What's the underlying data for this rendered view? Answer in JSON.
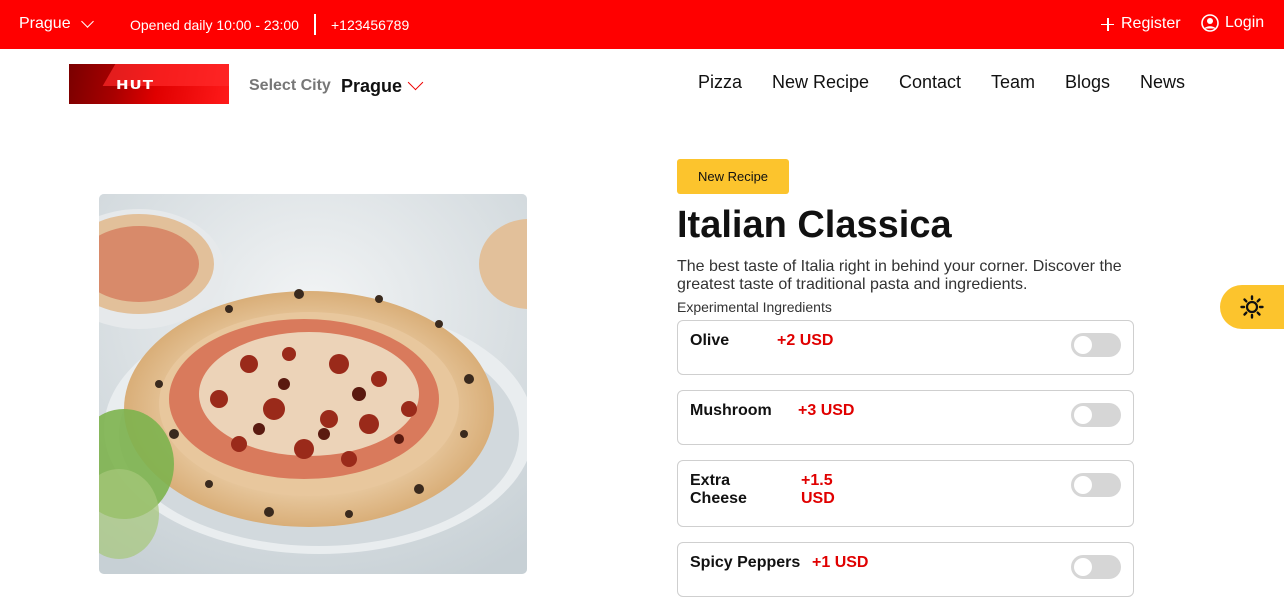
{
  "topbar": {
    "city": "Prague",
    "hours": "Opened daily 10:00 - 23:00",
    "phone": "+123456789",
    "register": "Register",
    "login": "Login"
  },
  "header": {
    "logo_text": "HUT",
    "select_city_label": "Select City",
    "selected_city": "Prague",
    "nav": [
      "Pizza",
      "New Recipe",
      "Contact",
      "Team",
      "Blogs",
      "News"
    ]
  },
  "main": {
    "badge": "New Recipe",
    "title": "Italian Classica",
    "description": "The best taste of Italia right in behind your corner. Discover the greatest taste of traditional pasta and ingredients.",
    "ingredients_label": "Experimental Ingredients",
    "ingredients": [
      {
        "name": "Olive",
        "price": "+2 USD",
        "enabled": false
      },
      {
        "name": "Mushroom",
        "price": "+3 USD",
        "enabled": false
      },
      {
        "name": "Extra Cheese",
        "price": "+1.5 USD",
        "enabled": false
      },
      {
        "name": "Spicy Peppers",
        "price": "+1 USD",
        "enabled": false
      }
    ]
  },
  "icons": {
    "city_dropdown": "chevron-down-icon",
    "register": "plus-icon",
    "login": "user-circle-icon",
    "theme": "sun-icon"
  },
  "colors": {
    "brand_red": "#ff0000",
    "accent_yellow": "#fcc42d",
    "price_red": "#e00000"
  }
}
